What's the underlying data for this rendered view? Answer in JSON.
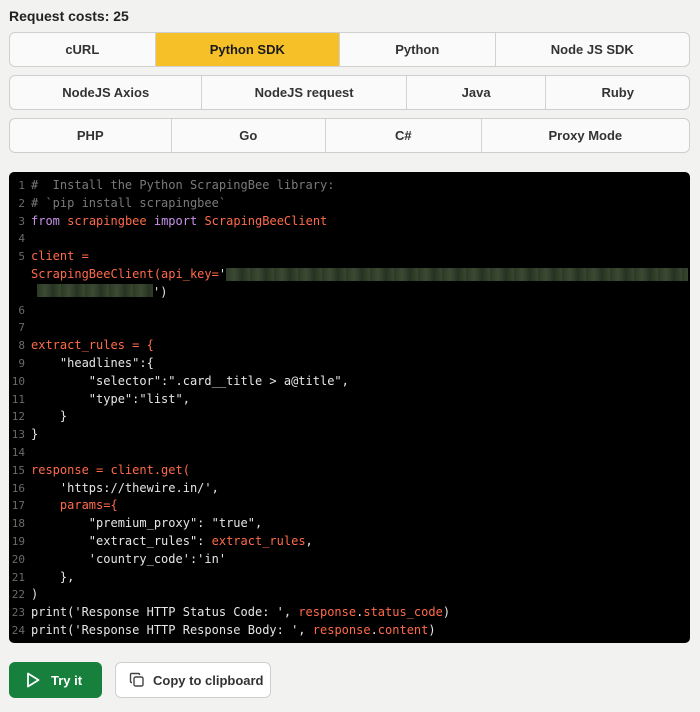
{
  "header": {
    "title": "Request costs: 25"
  },
  "tabs": {
    "row1": [
      {
        "label": "cURL",
        "active": false
      },
      {
        "label": "Python SDK",
        "active": true
      },
      {
        "label": "Python",
        "active": false
      },
      {
        "label": "Node JS SDK",
        "active": false
      }
    ],
    "row2": [
      {
        "label": "NodeJS Axios"
      },
      {
        "label": "NodeJS request"
      },
      {
        "label": "Java"
      },
      {
        "label": "Ruby"
      }
    ],
    "row3": [
      {
        "label": "PHP"
      },
      {
        "label": "Go"
      },
      {
        "label": "C#"
      },
      {
        "label": "Proxy Mode"
      }
    ]
  },
  "code": {
    "line_numbers": [
      "1",
      "2",
      "3",
      "4",
      "5",
      "",
      "6",
      "7",
      "8",
      "9",
      "10",
      "11",
      "12",
      "13",
      "14",
      "15",
      "16",
      "17",
      "18",
      "19",
      "20",
      "21",
      "22",
      "23",
      "24"
    ],
    "l1": "#  Install the Python ScrapingBee library:",
    "l2": "# `pip install scrapingbee`",
    "l3_from": "from",
    "l3_mod": "scrapingbee",
    "l3_import": "import",
    "l3_cls": "ScrapingBeeClient",
    "l5": "client =",
    "l5b_cls": "ScrapingBeeClient(api_key=",
    "l5b_quote": "'",
    "l5c_end": "')",
    "l8": "extract_rules = {",
    "l9": "    \"headlines\":{",
    "l10": "        \"selector\":\".card__title > a@title\",",
    "l11": "        \"type\":\"list\",",
    "l12": "    }",
    "l13": "}",
    "l15_var": "response",
    "l15_rest": " = client.get(",
    "l16": "    'https://thewire.in/',",
    "l17": "    params={",
    "l18": "        \"premium_proxy\": \"true\",",
    "l19_a": "        \"extract_rules\": ",
    "l19_b": "extract_rules",
    "l19_c": ",",
    "l20": "        'country_code':'in'",
    "l21": "    },",
    "l22": ")",
    "l23_a": "print('Response HTTP Status Code: ', ",
    "l23_b": "response",
    "l23_c": ".",
    "l23_d": "status_code",
    "l23_e": ")",
    "l24_a": "print('Response HTTP Response Body: ', ",
    "l24_b": "response",
    "l24_c": ".",
    "l24_d": "content",
    "l24_e": ")"
  },
  "actions": {
    "try_label": "Try it",
    "copy_label": "Copy to clipboard"
  },
  "colors": {
    "active_tab": "#f6c028",
    "try_button": "#17803d",
    "keyword": "#c792ea",
    "name": "#ff6a4a"
  }
}
